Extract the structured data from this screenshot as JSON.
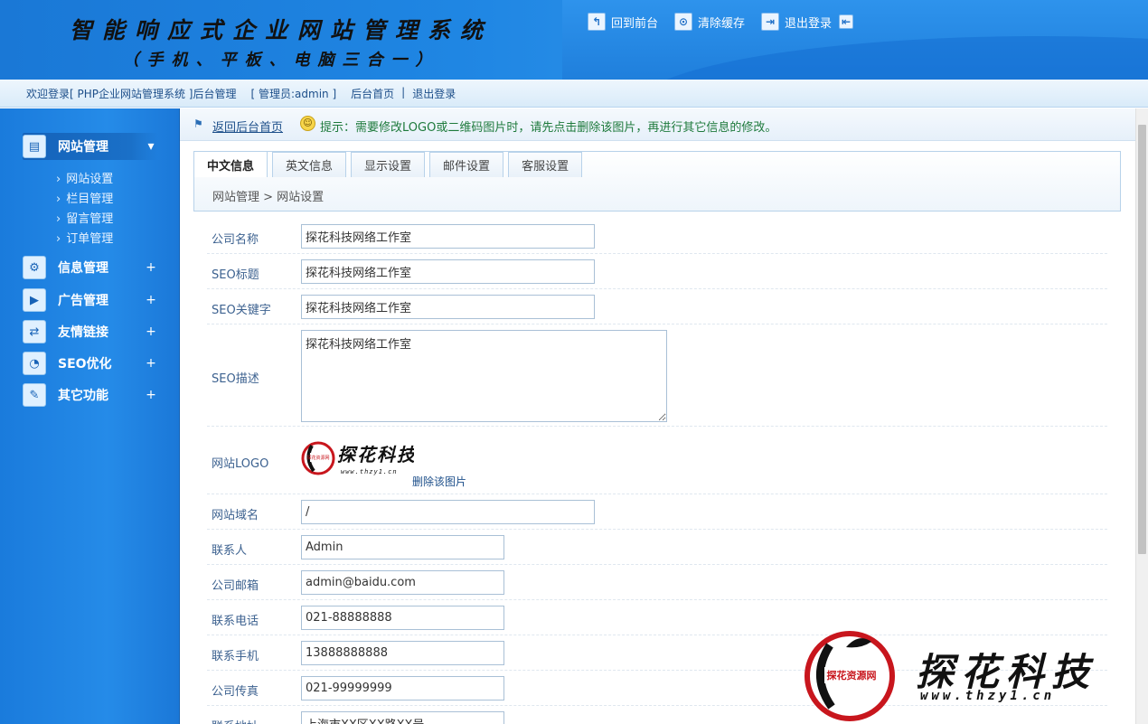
{
  "header": {
    "title": "智能响应式企业网站管理系统",
    "subtitle": "（手机、平板、电脑三合一）",
    "links": [
      {
        "label": "回到前台",
        "icon": "back-arrow-icon"
      },
      {
        "label": "清除缓存",
        "icon": "trash-icon"
      },
      {
        "label": "退出登录",
        "icon": "logout-icon"
      }
    ]
  },
  "welcome": {
    "text": "欢迎登录[ PHP企业网站管理系统 ]后台管理",
    "admin": "[ 管理员:admin ]",
    "home": "后台首页",
    "sep": "|",
    "logout": "退出登录"
  },
  "sidebar": {
    "groups": [
      {
        "label": "网站管理",
        "toggle": "▾",
        "icon": "website-manage-icon",
        "active": true,
        "items": [
          "网站设置",
          "栏目管理",
          "留言管理",
          "订单管理"
        ]
      },
      {
        "label": "信息管理",
        "toggle": "+",
        "icon": "gear-icon"
      },
      {
        "label": "广告管理",
        "toggle": "+",
        "icon": "play-icon"
      },
      {
        "label": "友情链接",
        "toggle": "+",
        "icon": "link-icon"
      },
      {
        "label": "SEO优化",
        "toggle": "+",
        "icon": "chat-icon"
      },
      {
        "label": "其它功能",
        "toggle": "+",
        "icon": "tool-icon"
      }
    ]
  },
  "tip": {
    "home_link": "返回后台首页",
    "text": "提示：需要修改LOGO或二维码图片时，请先点击删除该图片，再进行其它信息的修改。"
  },
  "tabs": [
    "中文信息",
    "英文信息",
    "显示设置",
    "邮件设置",
    "客服设置"
  ],
  "breadcrumb": "网站管理 > 网站设置",
  "form": {
    "company_name": {
      "label": "公司名称",
      "value": "探花科技网络工作室"
    },
    "seo_title": {
      "label": "SEO标题",
      "value": "探花科技网络工作室"
    },
    "seo_keywords": {
      "label": "SEO关键字",
      "value": "探花科技网络工作室"
    },
    "seo_desc": {
      "label": "SEO描述",
      "value": "探花科技网络工作室"
    },
    "logo": {
      "label": "网站LOGO",
      "delete": "删除该图片",
      "logo_text": "探花科技",
      "logo_url": "www.thzy1.cn"
    },
    "domain": {
      "label": "网站域名",
      "value": "/"
    },
    "contact": {
      "label": "联系人",
      "value": "Admin"
    },
    "email": {
      "label": "公司邮箱",
      "value": "admin@baidu.com"
    },
    "phone": {
      "label": "联系电话",
      "value": "021-88888888"
    },
    "mobile": {
      "label": "联系手机",
      "value": "13888888888"
    },
    "fax": {
      "label": "公司传真",
      "value": "021-99999999"
    },
    "address": {
      "label": "联系地址",
      "value": "上海市XX区XX路XX号"
    }
  },
  "watermark": {
    "text": "探花科技",
    "url": "www.thzy1.cn",
    "badge": "探花资源网"
  }
}
